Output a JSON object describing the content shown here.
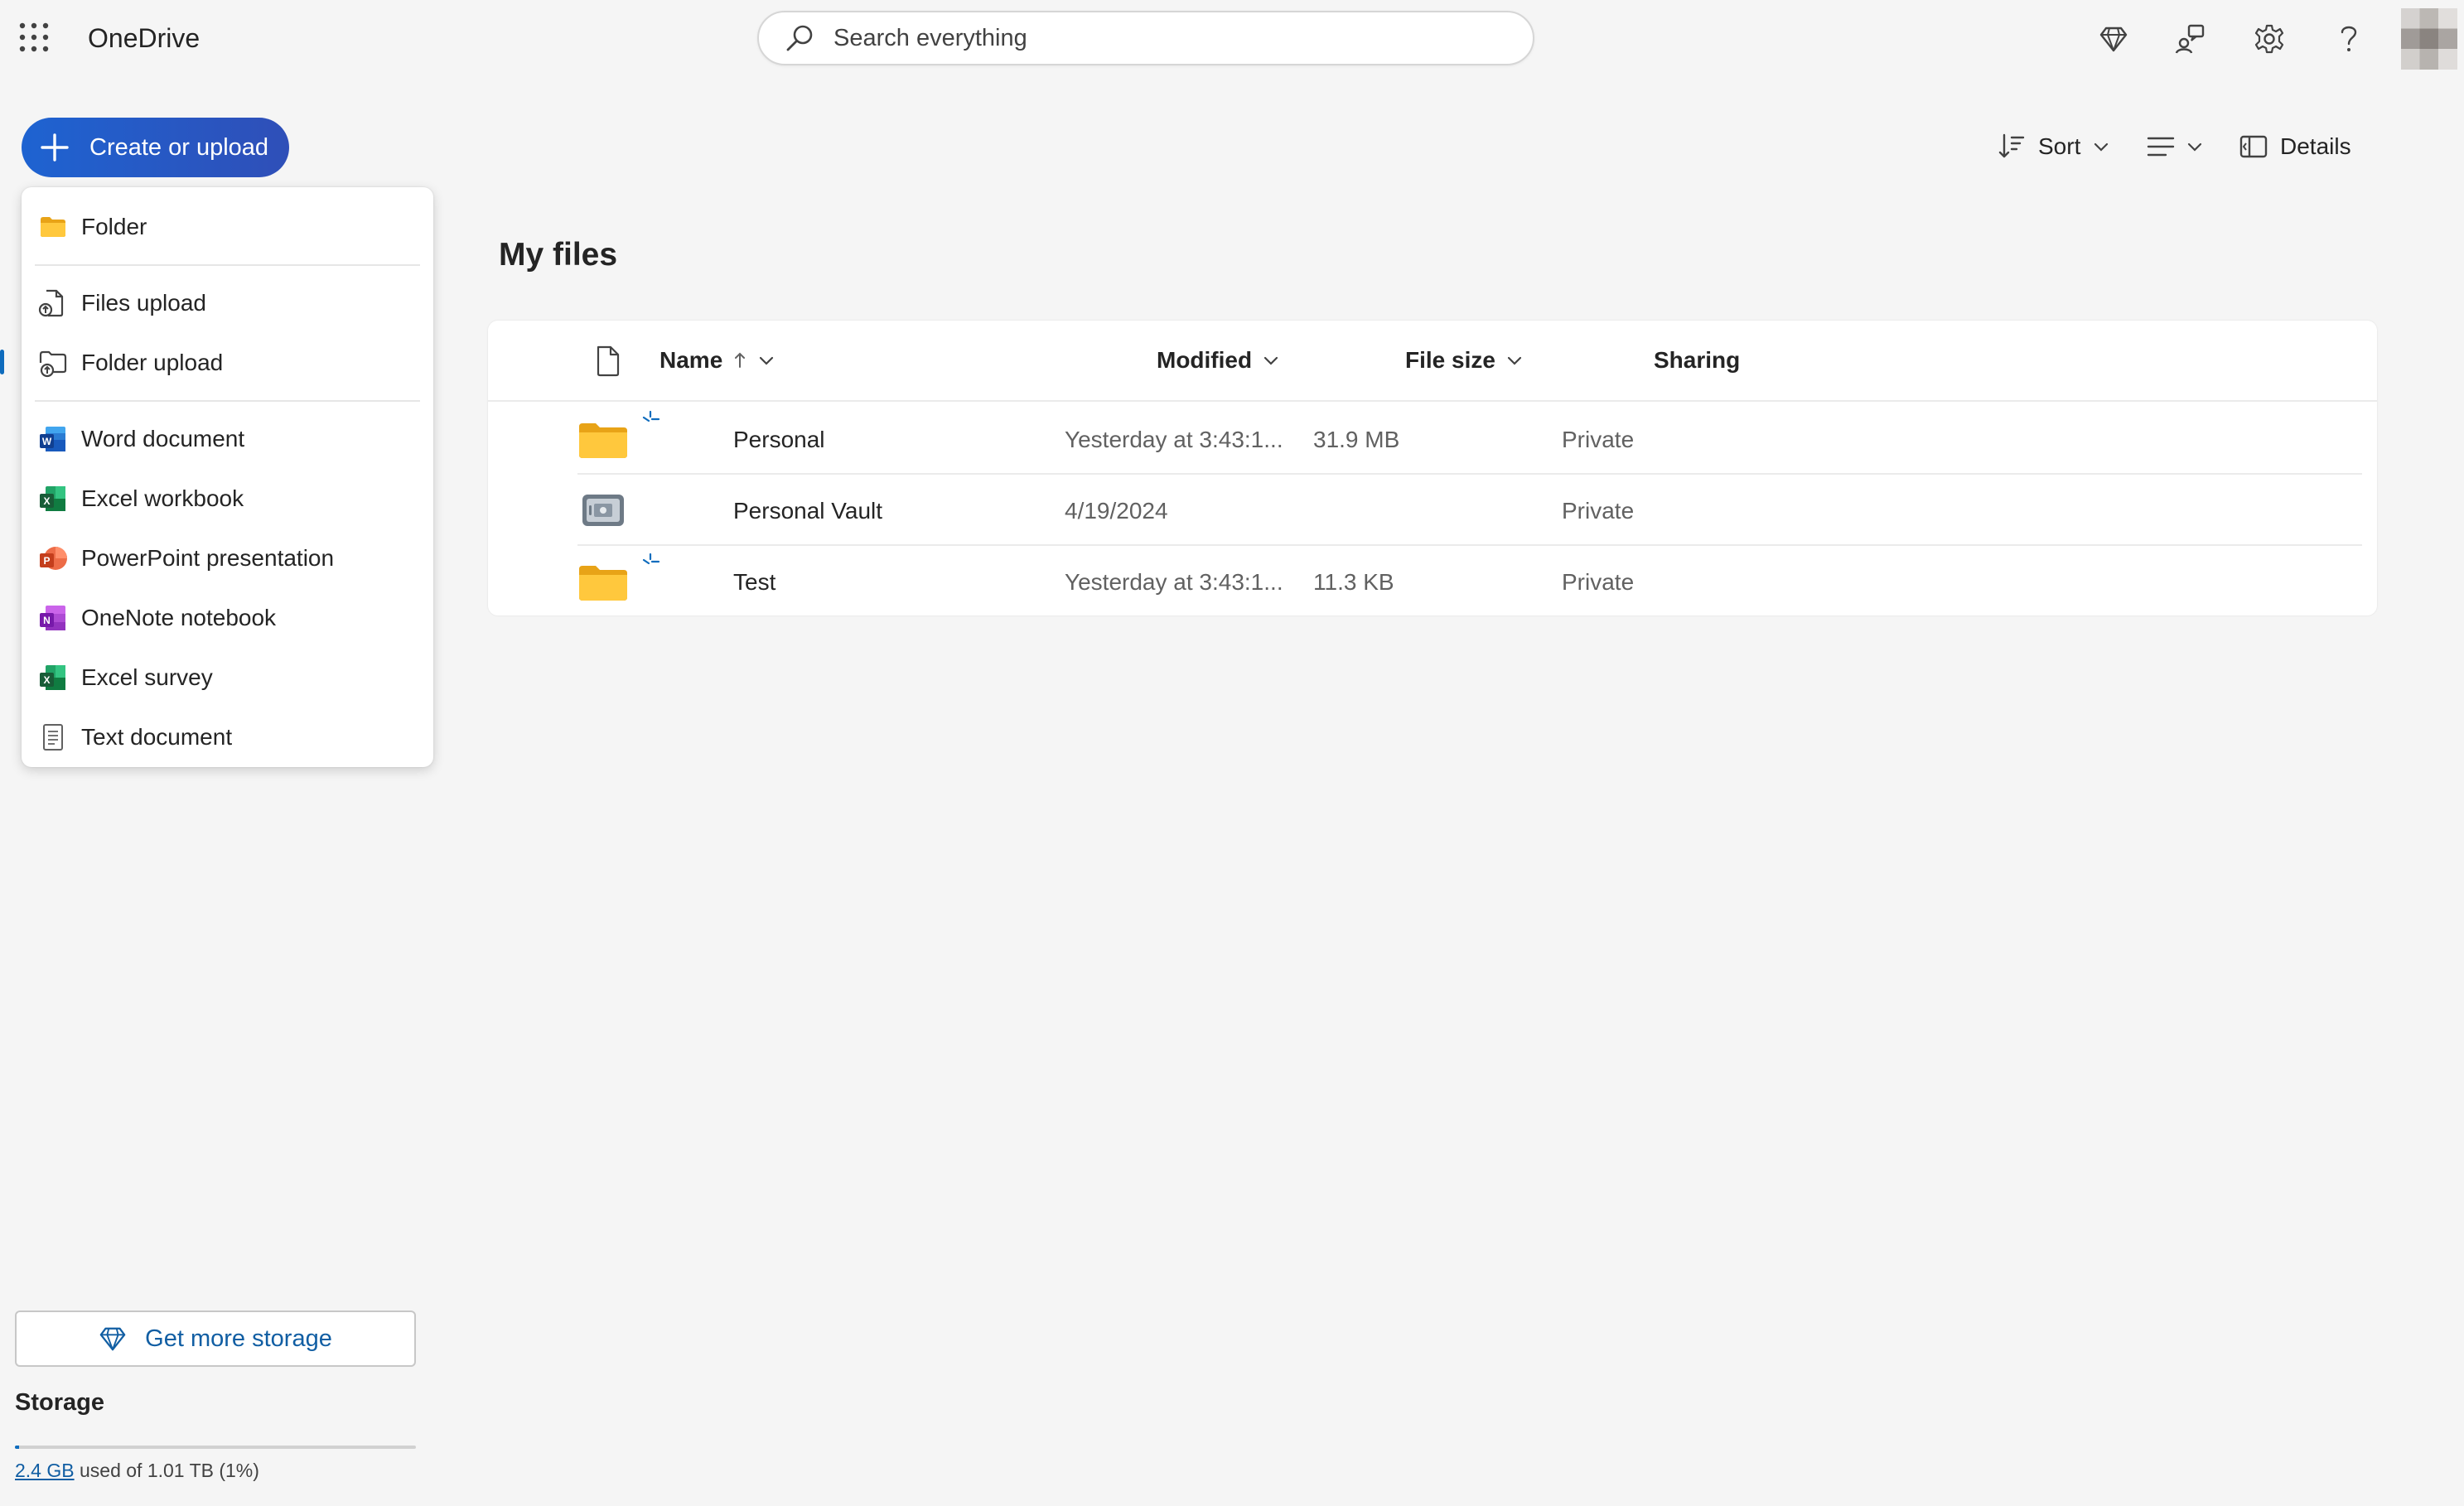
{
  "app": {
    "title": "OneDrive"
  },
  "search": {
    "placeholder": "Search everything"
  },
  "create_button": {
    "label": "Create or upload"
  },
  "create_menu": {
    "items": [
      {
        "label": "Folder",
        "icon": "folder-icon"
      },
      {
        "label": "Files upload",
        "icon": "file-upload-icon"
      },
      {
        "label": "Folder upload",
        "icon": "folder-upload-icon"
      },
      {
        "label": "Word document",
        "icon": "word-icon"
      },
      {
        "label": "Excel workbook",
        "icon": "excel-icon"
      },
      {
        "label": "PowerPoint presentation",
        "icon": "powerpoint-icon"
      },
      {
        "label": "OneNote notebook",
        "icon": "onenote-icon"
      },
      {
        "label": "Excel survey",
        "icon": "excel-survey-icon"
      },
      {
        "label": "Text document",
        "icon": "text-document-icon"
      }
    ]
  },
  "command_bar": {
    "sort": "Sort",
    "details": "Details"
  },
  "page": {
    "title": "My files"
  },
  "table": {
    "columns": {
      "name": "Name",
      "modified": "Modified",
      "file_size": "File size",
      "sharing": "Sharing"
    },
    "rows": [
      {
        "name": "Personal",
        "modified": "Yesterday at 3:43:1...",
        "size": "31.9 MB",
        "sharing": "Private",
        "type": "folder"
      },
      {
        "name": "Personal Vault",
        "modified": "4/19/2024",
        "size": "",
        "sharing": "Private",
        "type": "vault"
      },
      {
        "name": "Test",
        "modified": "Yesterday at 3:43:1...",
        "size": "11.3 KB",
        "sharing": "Private",
        "type": "folder"
      }
    ]
  },
  "storage": {
    "get_more_label": "Get more storage",
    "title": "Storage",
    "used_link": "2.4 GB",
    "used_text": " used of 1.01 TB (1%)",
    "used_percent": 1
  },
  "colors": {
    "accent": "#0f6cbd",
    "create_button": "#1f5cc8",
    "folder": "#ffc83d"
  }
}
